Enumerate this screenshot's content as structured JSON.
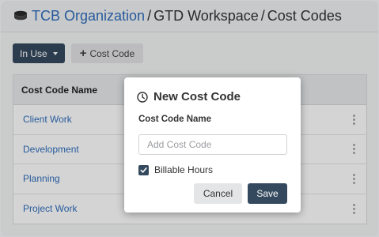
{
  "breadcrumb": {
    "organization": "TCB Organization",
    "separator": "/",
    "workspace": "GTD Workspace",
    "page": "Cost Codes"
  },
  "toolbar": {
    "filter_label": "In Use",
    "add_label": "Cost Code"
  },
  "table": {
    "header": "Cost Code Name",
    "rows": [
      "Client Work",
      "Development",
      "Planning",
      "Project Work"
    ]
  },
  "modal": {
    "title": "New Cost Code",
    "field_label": "Cost Code Name",
    "field_value": "",
    "field_placeholder": "Add Cost Code",
    "checkbox_label": "Billable Hours",
    "checkbox_checked": true,
    "cancel_label": "Cancel",
    "save_label": "Save"
  },
  "colors": {
    "accent": "#34495e",
    "link": "#2f6ebd"
  },
  "icons": {
    "organization": "organization-icon",
    "add": "plus-icon",
    "dropdown": "caret-down-icon",
    "modal_title": "clock-icon",
    "row_menu": "kebab-menu-icon",
    "checkbox": "checkmark-icon"
  }
}
